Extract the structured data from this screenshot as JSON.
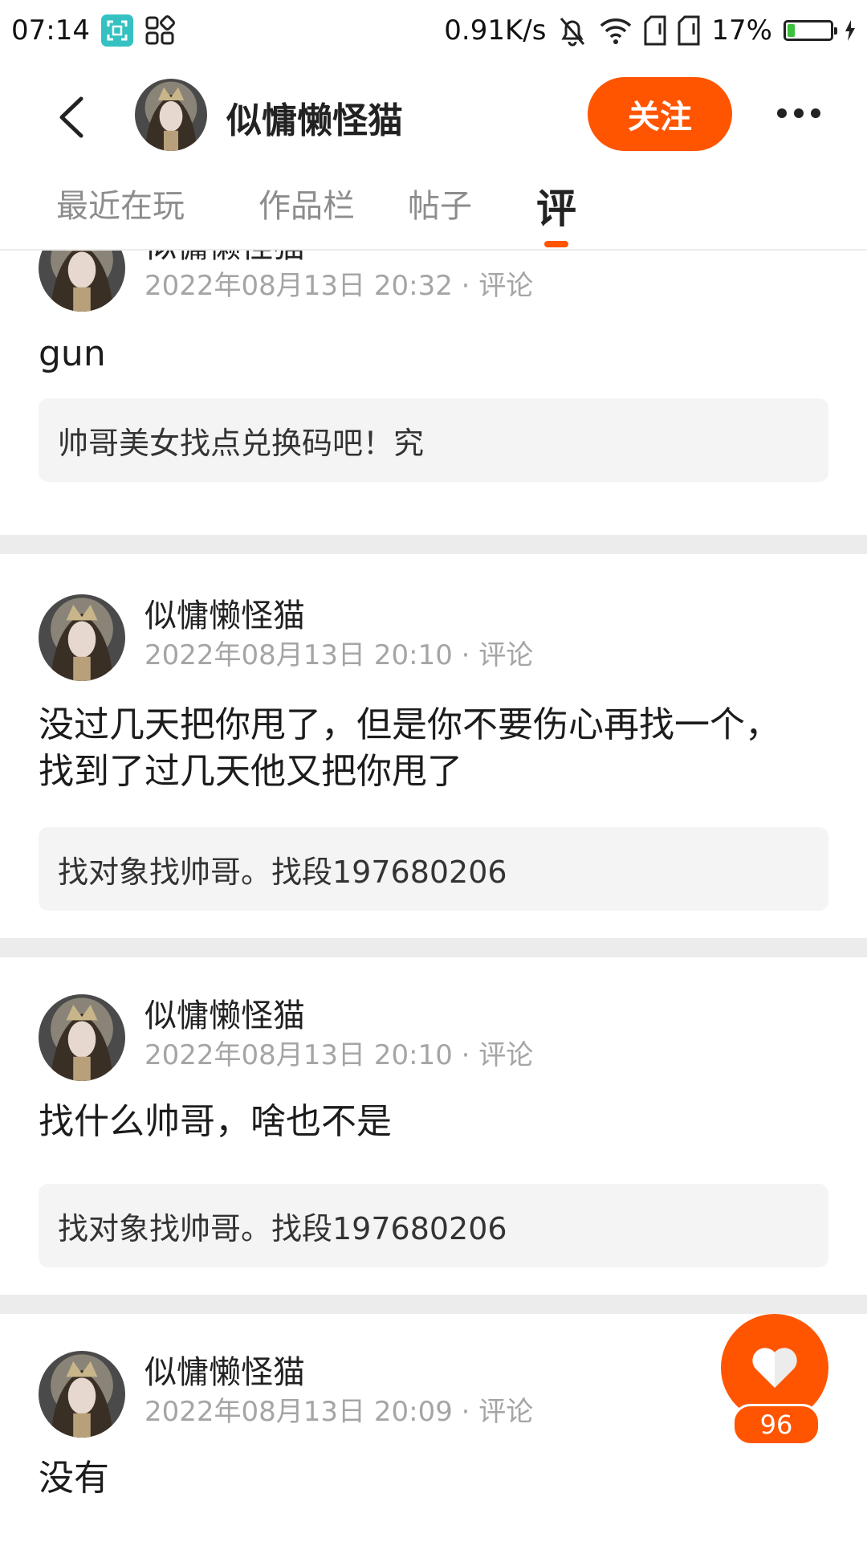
{
  "status_bar": {
    "time": "07:14",
    "net_speed": "0.91K/s",
    "battery": "17%",
    "battery_level": 0.17,
    "icons": [
      "screenshot-app-icon",
      "apps-grid-icon",
      "bell-off-icon",
      "wifi-icon",
      "sim1-icon",
      "sim2-icon",
      "battery-icon"
    ]
  },
  "header": {
    "username": "似慵懒怪猫",
    "follow_label": "关注",
    "accent_color": "#ff5500"
  },
  "tabs": [
    {
      "label": "最近在玩",
      "active": false
    },
    {
      "label": "作品栏",
      "active": false
    },
    {
      "label": "帖子",
      "active": false
    },
    {
      "label": "评",
      "active": true
    }
  ],
  "posts": [
    {
      "author": "似慵懒怪猫",
      "date": "2022年08月13日 20:32",
      "type": "评论",
      "text": "gun",
      "quote": "帅哥美女找点兑换码吧！究"
    },
    {
      "author": "似慵懒怪猫",
      "date": "2022年08月13日 20:10",
      "type": "评论",
      "text": "没过几天把你甩了，但是你不要伤心再找一个，找到了过几天他又把你甩了",
      "quote": "找对象找帅哥。找段197680206"
    },
    {
      "author": "似慵懒怪猫",
      "date": "2022年08月13日 20:10",
      "type": "评论",
      "text": "找什么帅哥，啥也不是",
      "quote": "找对象找帅哥。找段197680206"
    },
    {
      "author": "似慵懒怪猫",
      "date": "2022年08月13日 20:09",
      "type": "评论",
      "text": "没有",
      "quote": ""
    }
  ],
  "like": {
    "count": "96"
  }
}
